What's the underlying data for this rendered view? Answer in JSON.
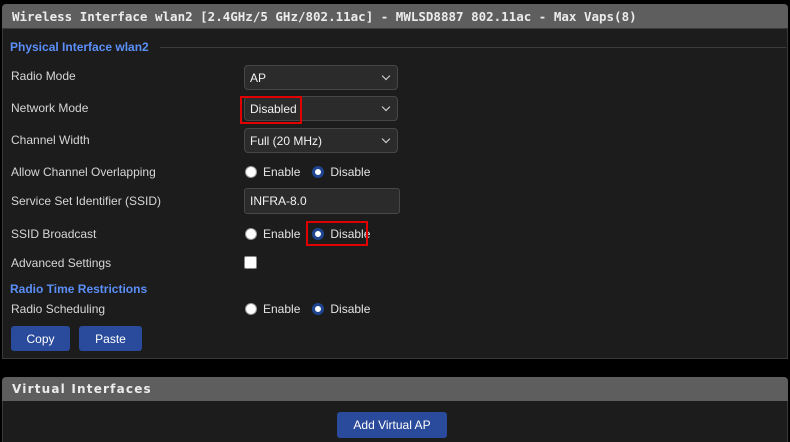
{
  "header": {
    "title": "Wireless Interface wlan2 [2.4GHz/5 GHz/802.11ac] - MWLSD8887 802.11ac - Max Vaps(8)"
  },
  "physical": {
    "legend": "Physical Interface wlan2",
    "radio_mode": {
      "label": "Radio Mode",
      "value": "AP"
    },
    "network_mode": {
      "label": "Network Mode",
      "value": "Disabled"
    },
    "channel_width": {
      "label": "Channel Width",
      "value": "Full (20 MHz)"
    },
    "channel_overlap": {
      "label": "Allow Channel Overlapping",
      "enable": "Enable",
      "disable": "Disable",
      "selected": "Disable"
    },
    "ssid": {
      "label": "Service Set Identifier (SSID)",
      "value": "INFRA-8.0"
    },
    "ssid_broadcast": {
      "label": "SSID Broadcast",
      "enable": "Enable",
      "disable": "Disable",
      "selected": "Disable"
    },
    "advanced": {
      "label": "Advanced Settings",
      "checked": false
    }
  },
  "radio_time": {
    "title": "Radio Time Restrictions",
    "scheduling": {
      "label": "Radio Scheduling",
      "enable": "Enable",
      "disable": "Disable",
      "selected": "Disable"
    }
  },
  "buttons": {
    "copy": "Copy",
    "paste": "Paste"
  },
  "virtual": {
    "title": "Virtual Interfaces",
    "add_button": "Add Virtual AP"
  },
  "colors": {
    "accent": "#5b8ff9",
    "button": "#2a4b9b",
    "highlight": "#e00000",
    "header_bg": "#5e5e5e"
  }
}
